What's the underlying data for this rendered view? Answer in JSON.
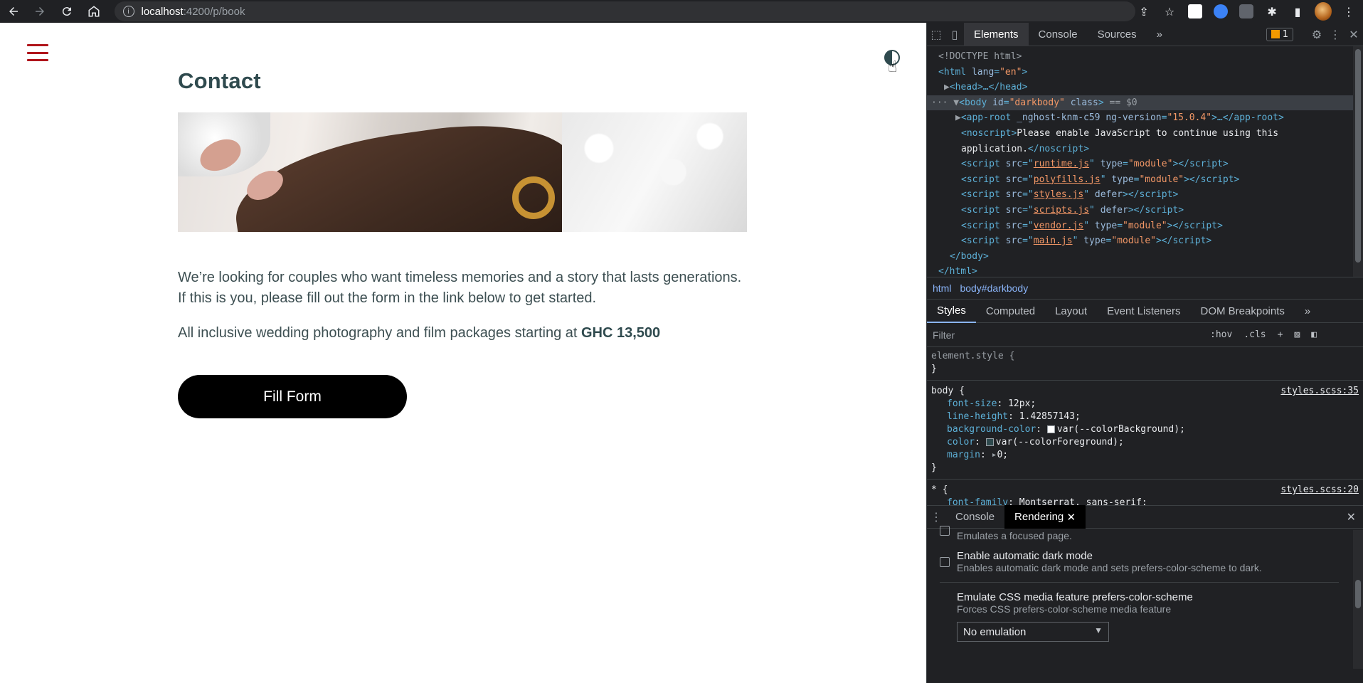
{
  "browser": {
    "url_host": "localhost",
    "url_path": ":4200/p/book",
    "info_glyph": "i"
  },
  "page": {
    "title": "Contact",
    "paragraph1": "We’re looking for couples who want timeless memories and a story that lasts generations. If this is you, please fill out the form in the link below to get started.",
    "paragraph2_prefix": "All inclusive wedding photography and film packages starting at ",
    "paragraph2_price": "GHC 13,500",
    "button_label": "Fill Form"
  },
  "colors": {
    "accent_red": "#b0151b",
    "title": "#2f4a4e",
    "button_bg": "#000000"
  },
  "devtools": {
    "tabs": [
      "Elements",
      "Console",
      "Sources"
    ],
    "more": "»",
    "issues_count": "1",
    "dom": {
      "l1": "<!DOCTYPE html>",
      "l2_tag": "<html ",
      "l2_attr": "lang",
      "l2_val": "\"en\"",
      "l2_end": ">",
      "l3": "<head>…</head>",
      "l4_tag": "<body ",
      "l4_a1": "id",
      "l4_v1": "\"darkbody\"",
      "l4_a2": " class",
      "l4_end": ">",
      "l4_sel": " == $0",
      "l5_tag": "<app-root ",
      "l5_a1": "_nghost-knm-c59 ng-version",
      "l5_v1": "\"15.0.4\"",
      "l5_end": ">…</app-root>",
      "l6_tag": "<noscript>",
      "l6_text": "Please enable JavaScript to continue using this",
      "l7_text": "application.",
      "l7_end": "</noscript>",
      "scripts": [
        {
          "src": "runtime.js",
          "attr": " type",
          "val": "\"module\""
        },
        {
          "src": "polyfills.js",
          "attr": " type",
          "val": "\"module\""
        },
        {
          "src": "styles.js",
          "attr": " defer",
          "val": ""
        },
        {
          "src": "scripts.js",
          "attr": " defer",
          "val": ""
        },
        {
          "src": "vendor.js",
          "attr": " type",
          "val": "\"module\""
        },
        {
          "src": "main.js",
          "attr": " type",
          "val": "\"module\""
        }
      ],
      "body_close": "</body>",
      "html_close": "</html>"
    },
    "breadcrumbs": [
      "html",
      "body#darkbody"
    ],
    "style_tabs": [
      "Styles",
      "Computed",
      "Layout",
      "Event Listeners",
      "DOM Breakpoints"
    ],
    "filter_placeholder": "Filter",
    "filter_hov": ":hov",
    "filter_cls": ".cls",
    "styles": {
      "element_style": "element.style {",
      "close": "}",
      "body_selector": "body {",
      "body_source": "styles.scss:35",
      "body_props": [
        {
          "name": "font-size",
          "value": "12px;"
        },
        {
          "name": "line-height",
          "value": "1.42857143;"
        },
        {
          "name": "background-color",
          "value": "var(--colorBackground);"
        },
        {
          "name": "color",
          "value": "var(--colorForeground);"
        },
        {
          "name": "margin",
          "value": "0;"
        }
      ],
      "star_selector": "* {",
      "star_source": "styles.scss:20",
      "star_prop_name": "font-family",
      "star_prop_value": "Montserrat, sans-serif;"
    },
    "drawer_tabs": [
      "Console",
      "Rendering"
    ],
    "rendering": {
      "focused_desc": "Emulates a focused page.",
      "dark_title": "Enable automatic dark mode",
      "dark_desc": "Enables automatic dark mode and sets prefers-color-scheme to dark.",
      "scheme_title": "Emulate CSS media feature prefers-color-scheme",
      "scheme_desc": "Forces CSS prefers-color-scheme media feature",
      "scheme_value": "No emulation"
    }
  }
}
